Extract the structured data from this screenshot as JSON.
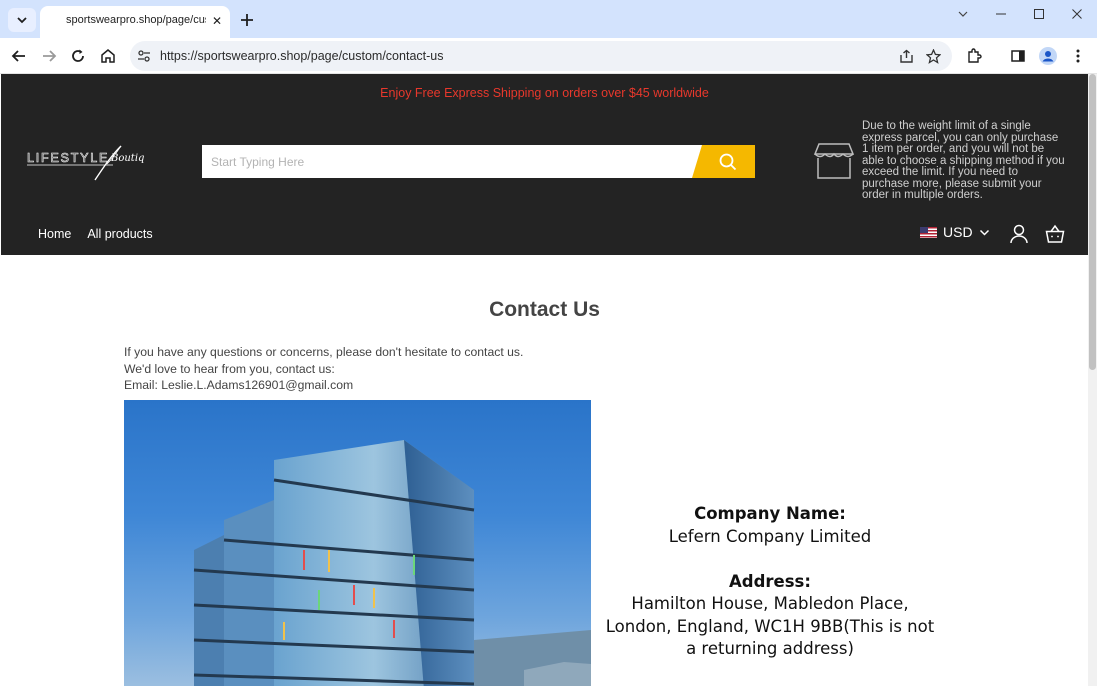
{
  "browser": {
    "tab_title": "sportswearpro.shop/page/custom/contact-us",
    "url": "https://sportswearpro.shop/page/custom/contact-us",
    "close_glyph": "✕",
    "new_tab_glyph": "+"
  },
  "site": {
    "promo": "Enjoy Free Express Shipping on orders over $45 worldwide",
    "logo_text_main": "LIFESTYLE",
    "logo_text_script": "Boutique",
    "search_placeholder": "Start Typing Here",
    "notice": "Due to the weight limit of a single express parcel, you can only purchase 1 item per order, and you will not be able to choose a shipping method if you exceed the limit. If you need to purchase more, please submit your order in multiple orders.",
    "nav": [
      {
        "label": "Home"
      },
      {
        "label": "All products"
      }
    ],
    "currency": "USD"
  },
  "content": {
    "title": "Contact Us",
    "intro_line1": "If you have any questions or concerns, please don't hesitate to contact us.",
    "intro_line2": "We'd love to hear from you, contact us:",
    "intro_line3": "Email: Leslie.L.Adams126901@gmail.com",
    "company_heading": "Company Name:",
    "company_name": "Lefern Company Limited",
    "address_heading": "Address:",
    "address": "Hamilton House, Mabledon Place, London, England, WC1H 9BB(This is not a returning address)"
  },
  "colors": {
    "header_bg": "#232323",
    "promo_text": "#e8382c",
    "search_button": "#f5b800",
    "tabstrip": "#d3e3fd"
  }
}
